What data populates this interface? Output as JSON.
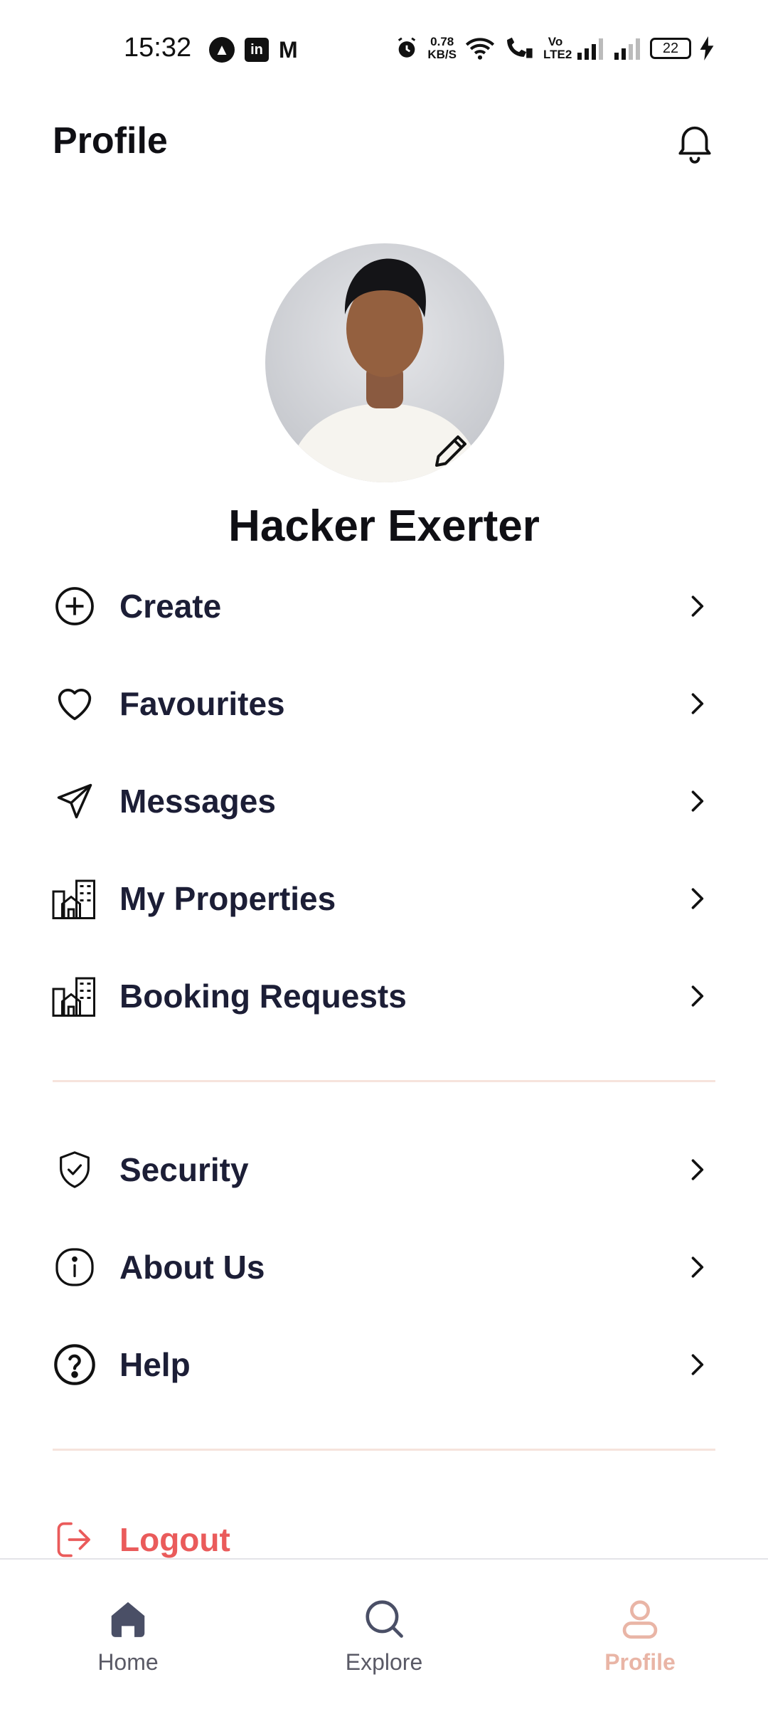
{
  "status_bar": {
    "time": "15:32",
    "net_speed_value": "0.78",
    "net_speed_unit": "KB/S",
    "volte": "Vo LTE2",
    "battery": "22",
    "left_icons": [
      "arrow-app-icon",
      "linkedin-icon",
      "gmail-icon"
    ],
    "right_icons": [
      "alarm-icon",
      "wifi-icon",
      "wifi-calling-icon",
      "volte-icon",
      "signal-icon",
      "signal-icon",
      "battery-icon",
      "charging-icon"
    ]
  },
  "header": {
    "title": "Profile",
    "notification_icon": "bell-icon"
  },
  "profile": {
    "name": "Hacker Exerter",
    "edit_icon": "pencil-icon"
  },
  "menu": {
    "items": [
      {
        "label": "Create",
        "icon": "plus-circle-icon"
      },
      {
        "label": "Favourites",
        "icon": "heart-icon"
      },
      {
        "label": "Messages",
        "icon": "send-icon"
      },
      {
        "label": "My Properties",
        "icon": "buildings-icon"
      },
      {
        "label": "Booking Requests",
        "icon": "buildings-icon"
      }
    ],
    "secondary_items": [
      {
        "label": "Security",
        "icon": "shield-check-icon"
      },
      {
        "label": "About Us",
        "icon": "info-icon"
      },
      {
        "label": "Help",
        "icon": "help-circle-icon"
      }
    ],
    "logout": {
      "label": "Logout",
      "icon": "logout-icon",
      "color": "#ea5b5b"
    }
  },
  "bottom_nav": {
    "items": [
      {
        "label": "Home",
        "icon": "home-icon"
      },
      {
        "label": "Explore",
        "icon": "search-icon"
      },
      {
        "label": "Profile",
        "icon": "user-icon"
      }
    ],
    "active": "Profile",
    "active_color": "#e9b5a6"
  },
  "colors": {
    "text_primary": "#1c1e36",
    "divider": "#f6e3dc",
    "logout": "#ea5b5b"
  }
}
